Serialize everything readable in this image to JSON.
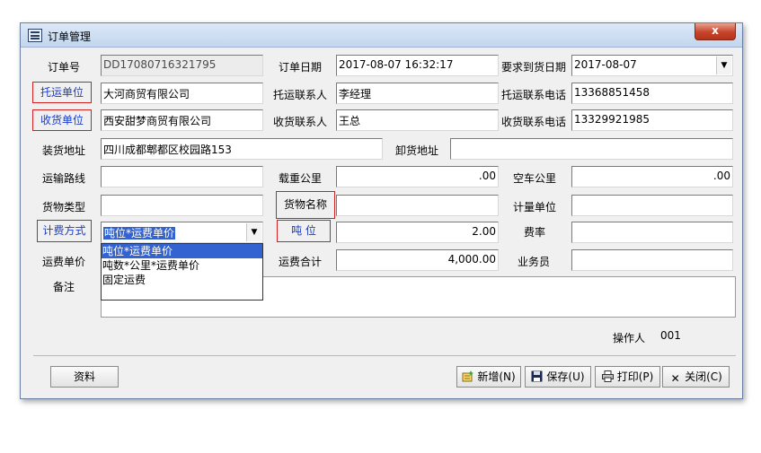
{
  "window": {
    "title": "订单管理",
    "close_label": "x"
  },
  "labels": {
    "order_no": "订单号",
    "order_date": "订单日期",
    "required_date": "要求到货日期",
    "shipper_unit": "托运单位",
    "shipper_contact": "托运联系人",
    "shipper_phone": "托运联系电话",
    "consignee_unit": "收货单位",
    "consignee_contact": "收货联系人",
    "consignee_phone": "收货联系电话",
    "load_address": "装货地址",
    "unload_address": "卸货地址",
    "route": "运输路线",
    "loaded_km": "载重公里",
    "empty_km": "空车公里",
    "goods_type": "货物类型",
    "goods_name": "货物名称",
    "unit_measure": "计量单位",
    "billing_method": "计费方式",
    "tonnage": "吨 位",
    "rate": "费率",
    "freight_unit_price": "运费单价",
    "freight_total": "运费合计",
    "salesman": "业务员",
    "remarks": "备注",
    "operator": "操作人"
  },
  "values": {
    "order_no": "DD17080716321795",
    "order_date": "2017-08-07 16:32:17",
    "required_date": "2017-08-07",
    "shipper_unit": "大河商贸有限公司",
    "shipper_contact": "李经理",
    "shipper_phone": "13368851458",
    "consignee_unit": "西安甜梦商贸有限公司",
    "consignee_contact": "王总",
    "consignee_phone": "13329921985",
    "load_address": "四川成都郫都区校园路153",
    "unload_address": "",
    "route": "",
    "loaded_km": ".00",
    "empty_km": ".00",
    "goods_type": "",
    "goods_name": "",
    "unit_measure": "",
    "billing_method": "吨位*运费单价",
    "tonnage": "2.00",
    "rate": "",
    "freight_unit_price": "",
    "freight_total": "4,000.00",
    "salesman": "",
    "remarks": "",
    "operator": "001"
  },
  "billing_options": [
    "吨位*运费单价",
    "吨数*公里*运费单价",
    "固定运费"
  ],
  "buttons": {
    "data": "资料",
    "add": "新增(N)",
    "save": "保存(U)",
    "print": "打印(P)",
    "close": "关闭(C)"
  },
  "colors": {
    "label_highlight_border": "#d22020",
    "label_highlight_text": "#1a3cc8",
    "selection": "#3363d1"
  }
}
